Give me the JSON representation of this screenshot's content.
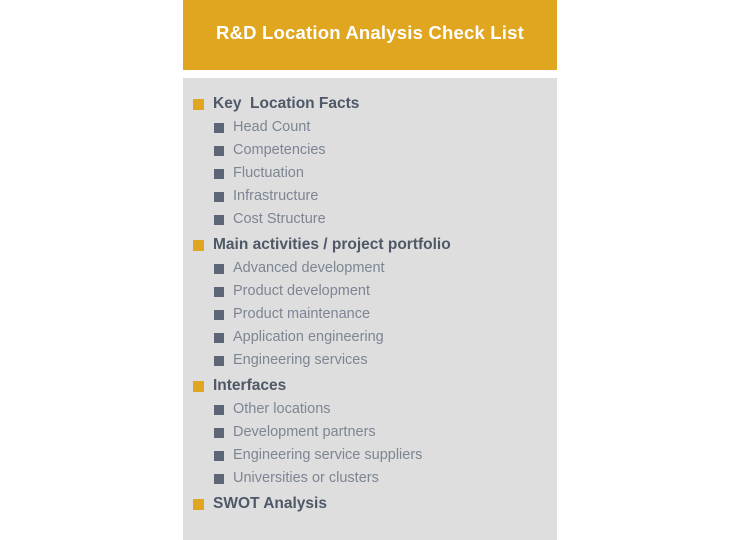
{
  "slide": {
    "title": "R&D Location Analysis Check List",
    "colors": {
      "banner": "#e0a620",
      "panel": "#dedede",
      "section_bullet": "#e0a620",
      "sub_bullet": "#5d6676",
      "section_text": "#4e5867",
      "sub_text": "#7d8593",
      "title_text": "#ffffff",
      "page_background": "#ffffff"
    }
  },
  "checklist": {
    "sections": [
      {
        "label": "Key  Location Facts",
        "bullet": "square-bullet-yellow-icon",
        "items": [
          {
            "label": "Head Count",
            "bullet": "square-bullet-gray-icon"
          },
          {
            "label": "Competencies",
            "bullet": "square-bullet-gray-icon"
          },
          {
            "label": "Fluctuation",
            "bullet": "square-bullet-gray-icon"
          },
          {
            "label": "Infrastructure",
            "bullet": "square-bullet-gray-icon"
          },
          {
            "label": "Cost Structure",
            "bullet": "square-bullet-gray-icon"
          }
        ]
      },
      {
        "label": "Main activities / project portfolio",
        "bullet": "square-bullet-yellow-icon",
        "items": [
          {
            "label": "Advanced development",
            "bullet": "square-bullet-gray-icon"
          },
          {
            "label": "Product development",
            "bullet": "square-bullet-gray-icon"
          },
          {
            "label": "Product maintenance",
            "bullet": "square-bullet-gray-icon"
          },
          {
            "label": "Application engineering",
            "bullet": "square-bullet-gray-icon"
          },
          {
            "label": "Engineering services",
            "bullet": "square-bullet-gray-icon"
          }
        ]
      },
      {
        "label": "Interfaces",
        "bullet": "square-bullet-yellow-icon",
        "items": [
          {
            "label": "Other locations",
            "bullet": "square-bullet-gray-icon"
          },
          {
            "label": "Development partners",
            "bullet": "square-bullet-gray-icon"
          },
          {
            "label": "Engineering service suppliers",
            "bullet": "square-bullet-gray-icon"
          },
          {
            "label": "Universities or clusters",
            "bullet": "square-bullet-gray-icon"
          }
        ]
      },
      {
        "label": "SWOT Analysis",
        "bullet": "square-bullet-yellow-icon",
        "items": []
      }
    ]
  }
}
